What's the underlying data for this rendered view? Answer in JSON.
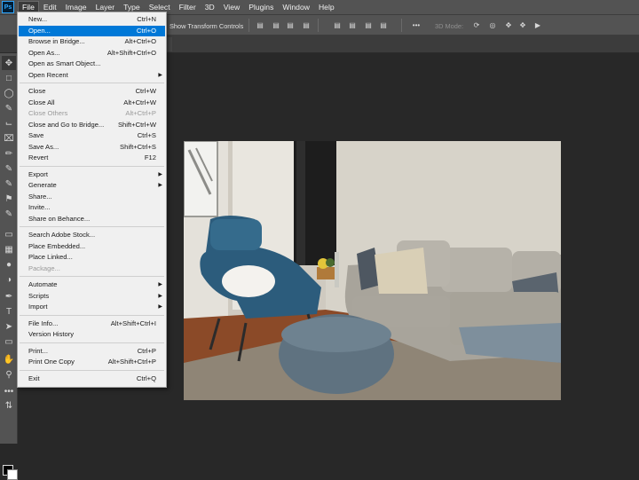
{
  "menubar": {
    "logo": "Ps",
    "items": [
      "File",
      "Edit",
      "Image",
      "Layer",
      "Type",
      "Select",
      "Filter",
      "3D",
      "View",
      "Plugins",
      "Window",
      "Help"
    ]
  },
  "options": {
    "transform_label": "Show Transform Controls",
    "mode_3d": "3D Mode:"
  },
  "file_menu": {
    "groups": [
      [
        {
          "label": "New...",
          "shortcut": "Ctrl+N"
        },
        {
          "label": "Open...",
          "shortcut": "Ctrl+O",
          "highlighted": true
        },
        {
          "label": "Browse in Bridge...",
          "shortcut": "Alt+Ctrl+O"
        },
        {
          "label": "Open As...",
          "shortcut": "Alt+Shift+Ctrl+O"
        },
        {
          "label": "Open as Smart Object..."
        },
        {
          "label": "Open Recent",
          "submenu": true
        }
      ],
      [
        {
          "label": "Close",
          "shortcut": "Ctrl+W"
        },
        {
          "label": "Close All",
          "shortcut": "Alt+Ctrl+W"
        },
        {
          "label": "Close Others",
          "shortcut": "Alt+Ctrl+P",
          "disabled": true
        },
        {
          "label": "Close and Go to Bridge...",
          "shortcut": "Shift+Ctrl+W"
        },
        {
          "label": "Save",
          "shortcut": "Ctrl+S"
        },
        {
          "label": "Save As...",
          "shortcut": "Shift+Ctrl+S"
        },
        {
          "label": "Revert",
          "shortcut": "F12"
        }
      ],
      [
        {
          "label": "Export",
          "submenu": true
        },
        {
          "label": "Generate",
          "submenu": true
        },
        {
          "label": "Share..."
        },
        {
          "label": "Invite..."
        },
        {
          "label": "Share on Behance..."
        }
      ],
      [
        {
          "label": "Search Adobe Stock..."
        },
        {
          "label": "Place Embedded..."
        },
        {
          "label": "Place Linked..."
        },
        {
          "label": "Package...",
          "disabled": true
        }
      ],
      [
        {
          "label": "Automate",
          "submenu": true
        },
        {
          "label": "Scripts",
          "submenu": true
        },
        {
          "label": "Import",
          "submenu": true
        }
      ],
      [
        {
          "label": "File Info...",
          "shortcut": "Alt+Shift+Ctrl+I"
        },
        {
          "label": "Version History"
        }
      ],
      [
        {
          "label": "Print...",
          "shortcut": "Ctrl+P"
        },
        {
          "label": "Print One Copy",
          "shortcut": "Alt+Shift+Ctrl+P"
        }
      ],
      [
        {
          "label": "Exit",
          "shortcut": "Ctrl+Q"
        }
      ]
    ]
  },
  "colors": {
    "menu_highlight": "#0078d7",
    "ui_panel": "#535353",
    "workspace": "#282828"
  }
}
